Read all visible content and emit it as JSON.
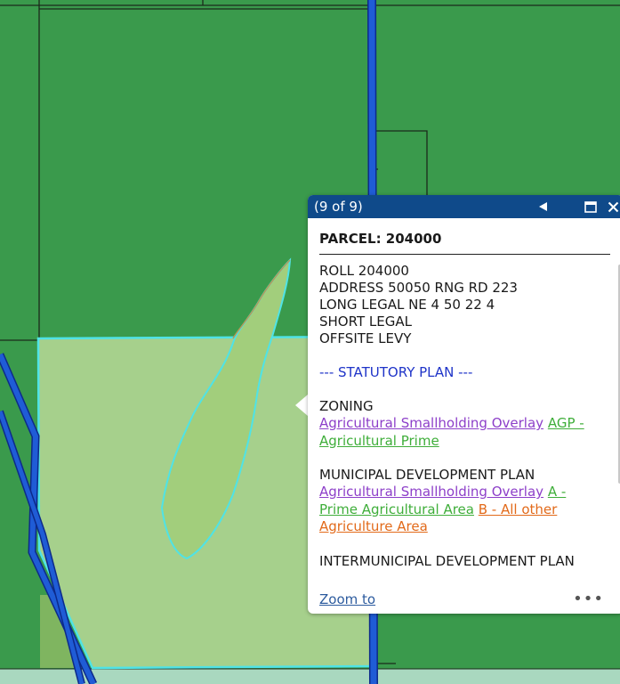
{
  "map": {
    "colors": {
      "agriculture": "#3a9a4c",
      "selected_parcel": "#a6d08c",
      "selection_outline": "#4fe3e6",
      "water_body": "#a2ce7c",
      "road_blue": "#1f5cd6",
      "boundary": "#1b2a1b",
      "bottom_strip": "#a9d8bf"
    }
  },
  "popup": {
    "count": "(9 of 9)",
    "prev_icon": "triangle-left-icon",
    "maximize_icon": "maximize-icon",
    "close_icon": "close-icon",
    "title": "PARCEL: 204000",
    "fields": [
      "ROLL 204000",
      "ADDRESS 50050 RNG RD 223",
      "LONG LEGAL NE 4 50 22 4",
      "SHORT LEGAL",
      "OFFSITE LEVY"
    ],
    "statutory_plan": "--- STATUTORY PLAN ---",
    "zoning": {
      "heading": "ZONING",
      "link1": "Agricultural Smallholding Overlay",
      "link2": "AGP - Agricultural Prime"
    },
    "mdp": {
      "heading": "MUNICIPAL DEVELOPMENT PLAN",
      "link1": "Agricultural Smallholding Overlay",
      "link2": "A - Prime Agricultural Area",
      "link3": "B - All other Agriculture Area"
    },
    "idp": {
      "heading": "INTERMUNICIPAL DEVELOPMENT PLAN"
    },
    "zoom_to": "Zoom to",
    "more": "•••"
  }
}
